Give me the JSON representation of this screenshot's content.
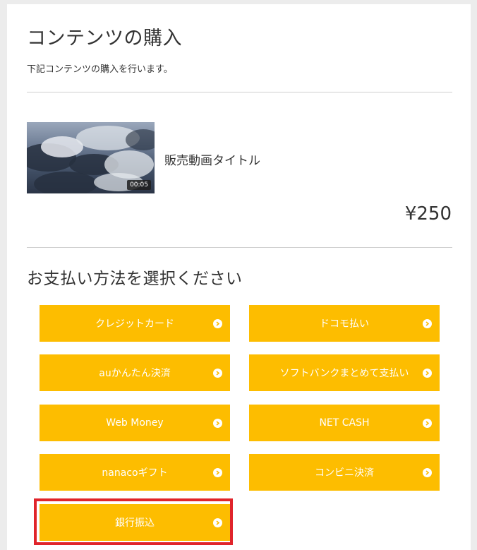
{
  "page": {
    "title": "コンテンツの購入",
    "subtitle": "下記コンテンツの購入を行います。"
  },
  "content": {
    "video_title": "販売動画タイトル",
    "duration": "00:05",
    "price": "¥250"
  },
  "payment": {
    "heading": "お支払い方法を選択ください",
    "accent_color": "#fdbd00",
    "highlight_color": "#e0242b",
    "methods": [
      {
        "label": "クレジットカード"
      },
      {
        "label": "ドコモ払い"
      },
      {
        "label": "auかんたん決済"
      },
      {
        "label": "ソフトバンクまとめて支払い"
      },
      {
        "label": "Web Money"
      },
      {
        "label": "NET CASH"
      },
      {
        "label": "nanacoギフト"
      },
      {
        "label": "コンビニ決済"
      },
      {
        "label": "銀行振込",
        "highlighted": true
      }
    ]
  }
}
